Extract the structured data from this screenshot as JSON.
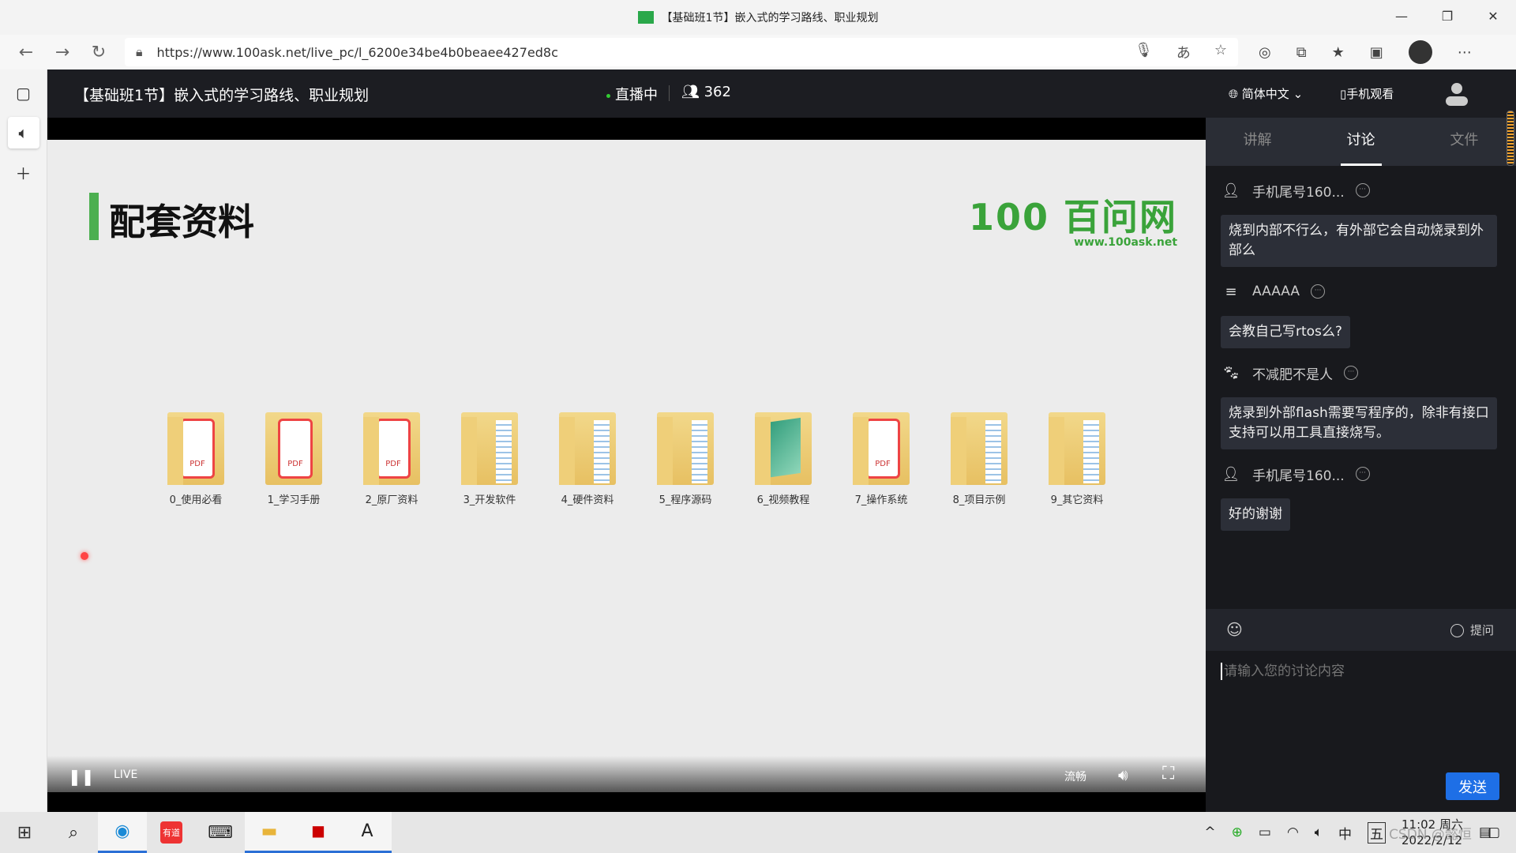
{
  "window": {
    "title": "【基础班1节】嵌入式的学习路线、职业规划",
    "minimize": "—",
    "maximize": "❐",
    "close": "✕"
  },
  "browser": {
    "url": "https://www.100ask.net/live_pc/l_6200e34be4b0beaee427ed8c",
    "back": "←",
    "forward": "→",
    "refresh": "↻"
  },
  "header": {
    "title": "【基础班1节】嵌入式的学习路线、职业规划",
    "status": "直播中",
    "viewers": "362",
    "language": "简体中文",
    "mobile": "手机观看"
  },
  "slide": {
    "heading": "配套资料",
    "logo_text": "100 百问网",
    "logo_url": "www.100ask.net",
    "folders": [
      {
        "label": "0_使用必看",
        "type": "pdf"
      },
      {
        "label": "1_学习手册",
        "type": "pdf"
      },
      {
        "label": "2_原厂资料",
        "type": "pdf"
      },
      {
        "label": "3_开发软件",
        "type": "docs"
      },
      {
        "label": "4_硬件资料",
        "type": "docs"
      },
      {
        "label": "5_程序源码",
        "type": "docs"
      },
      {
        "label": "6_视频教程",
        "type": "video"
      },
      {
        "label": "7_操作系统",
        "type": "pdf"
      },
      {
        "label": "8_项目示例",
        "type": "docs"
      },
      {
        "label": "9_其它资料",
        "type": "docs"
      }
    ]
  },
  "player": {
    "live": "LIVE",
    "quality": "流畅"
  },
  "sidebar": {
    "tabs": [
      "讲解",
      "讨论",
      "文件"
    ],
    "active_tab": "讨论",
    "messages": [
      {
        "user": "手机尾号160...",
        "text": "烧到内部不行么，有外部它会自动烧录到外部么"
      },
      {
        "user": "AAAAA",
        "text": "会教自己写rtos么?"
      },
      {
        "user": "不减肥不是人",
        "text": "烧录到外部flash需要写程序的，除非有接口支持可以用工具直接烧写。"
      },
      {
        "user": "手机尾号160...",
        "text": "好的谢谢"
      }
    ],
    "ask_label": "提问",
    "input_placeholder": "请输入您的讨论内容",
    "send": "发送"
  },
  "taskbar": {
    "time": "11:02 周六",
    "date": "2022/2/12",
    "ime": "中",
    "ime2": "五",
    "youdao": "有道",
    "watermark": "CSDN @懿恒"
  },
  "colors": {
    "accent": "#1e6fe6",
    "brand_green": "#3aa33a",
    "header_bg": "#1c1d22"
  }
}
